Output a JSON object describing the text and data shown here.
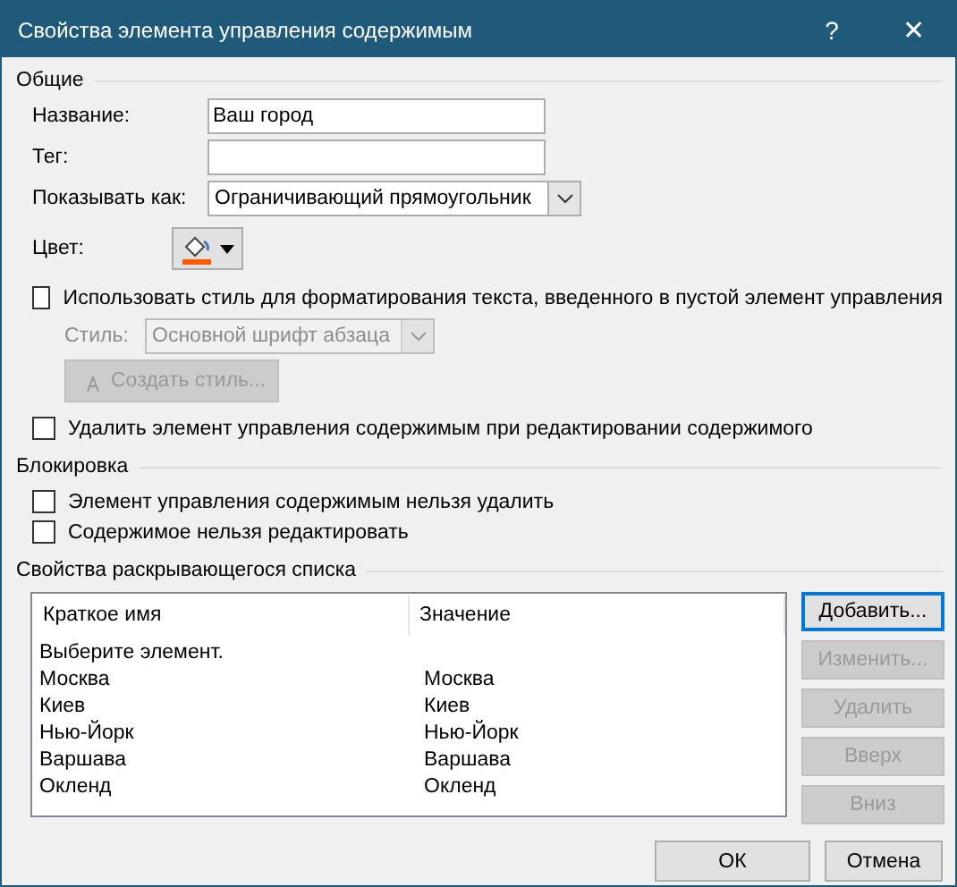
{
  "window": {
    "title": "Свойства элемента управления содержимым",
    "help": "?",
    "close": "✕"
  },
  "general": {
    "title": "Общие",
    "fields": [
      {
        "kind": "text",
        "label": "Название:",
        "value": "Ваш город"
      },
      {
        "kind": "text",
        "label": "Тег:"
      },
      {
        "kind": "select",
        "label": "Показывать как:",
        "value": "Ограничивающий прямоугольник"
      },
      {
        "kind": "color",
        "label": "Цвет:",
        "color": "#ff5a00"
      }
    ],
    "use_style": {
      "label": "Использовать стиль для форматирования текста, введенного в пустой элемент управления",
      "checked": false
    },
    "style": {
      "label": "Стиль:",
      "value": "Основной шрифт абзаца",
      "disabled": true
    },
    "create_style": {
      "label": "Создать стиль...",
      "disabled": true
    },
    "remove_on_edit": {
      "label": "Удалить элемент управления содержимым при редактировании содержимого",
      "checked": false
    }
  },
  "locking": {
    "title": "Блокировка",
    "options": [
      {
        "label": "Элемент управления содержимым нельзя удалить",
        "checked": false
      },
      {
        "label": "Содержимое нельзя редактировать",
        "checked": false
      }
    ]
  },
  "dropdown": {
    "title": "Свойства раскрывающегося списка",
    "columns": [
      "Краткое имя",
      "Значение"
    ],
    "rows": [
      {
        "name": "Выберите элемент."
      },
      {
        "name": "Москва",
        "value": "Москва"
      },
      {
        "name": "Киев",
        "value": "Киев"
      },
      {
        "name": "Нью-Йорк",
        "value": "Нью-Йорк"
      },
      {
        "name": "Варшава",
        "value": "Варшава"
      },
      {
        "name": "Окленд",
        "value": "Окленд"
      }
    ],
    "buttons": [
      {
        "label": "Добавить...",
        "disabled": false,
        "default": true
      },
      {
        "label": "Изменить...",
        "disabled": true,
        "default": false
      },
      {
        "label": "Удалить",
        "disabled": true,
        "default": false
      },
      {
        "label": "Вверх",
        "disabled": true,
        "default": false
      },
      {
        "label": "Вниз",
        "disabled": true,
        "default": false
      }
    ]
  },
  "footer": [
    {
      "label": "ОК"
    },
    {
      "label": "Отмена"
    }
  ]
}
